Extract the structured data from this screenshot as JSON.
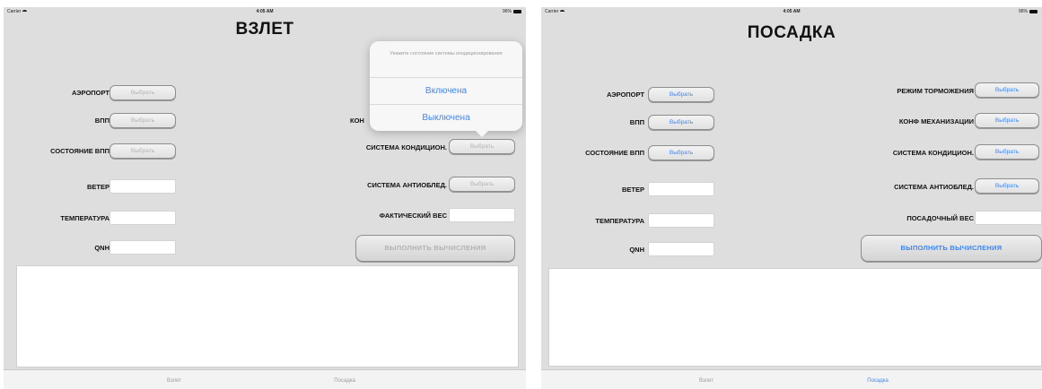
{
  "status_left": {
    "carrier": "Carrier",
    "time": "4:05 AM",
    "battery": "96%"
  },
  "status_right": {
    "carrier": "Carrier",
    "time": "4:05 AM",
    "battery": "96%"
  },
  "takeoff": {
    "title": "ВЗЛЕТ",
    "left_labels": [
      "АЭРОПОРТ",
      "ВПП",
      "СОСТОЯНИЕ ВПП",
      "ВЕТЕР",
      "ТЕМПЕРАТУРА",
      "QNH"
    ],
    "pick_label": "Выбрать",
    "right_labels": {
      "conf_partial": "КОН",
      "aircon": "СИСТЕМА КОНДИЦИОН.",
      "anti_ice": "СИСТЕМА АНТИОБЛЕД.",
      "weight": "ФАКТИЧЕСКИЙ ВЕС"
    },
    "calc_button": "ВЫПОЛНИТЬ ВЫЧИСЛЕНИЯ"
  },
  "popover": {
    "title": "Укажите состояние системы кондиционирования",
    "options": [
      "Включена",
      "Выключена"
    ]
  },
  "landing": {
    "title": "ПОСАДКА",
    "left_labels": [
      "АЭРОПОРТ",
      "ВПП",
      "СОСТОЯНИЕ ВПП",
      "ВЕТЕР",
      "ТЕМПЕРАТУРА",
      "QNH"
    ],
    "pick_label": "Выбрать",
    "right_labels": [
      "РЕЖИМ ТОРМОЖЕНИЯ",
      "КОНФ МЕХАНИЗАЦИИ",
      "СИСТЕМА КОНДИЦИОН.",
      "СИСТЕМА АНТИОБЛЕД."
    ],
    "weight_label": "ПОСАДОЧНЫЙ ВЕС",
    "calc_button": "ВЫПОЛНИТЬ ВЫЧИСЛЕНИЯ"
  },
  "tabs": [
    "Взлет",
    "Посадка"
  ],
  "colors": {
    "accent": "#3a86ff",
    "background": "#dedede",
    "disabled_text": "#b3b3b3"
  }
}
